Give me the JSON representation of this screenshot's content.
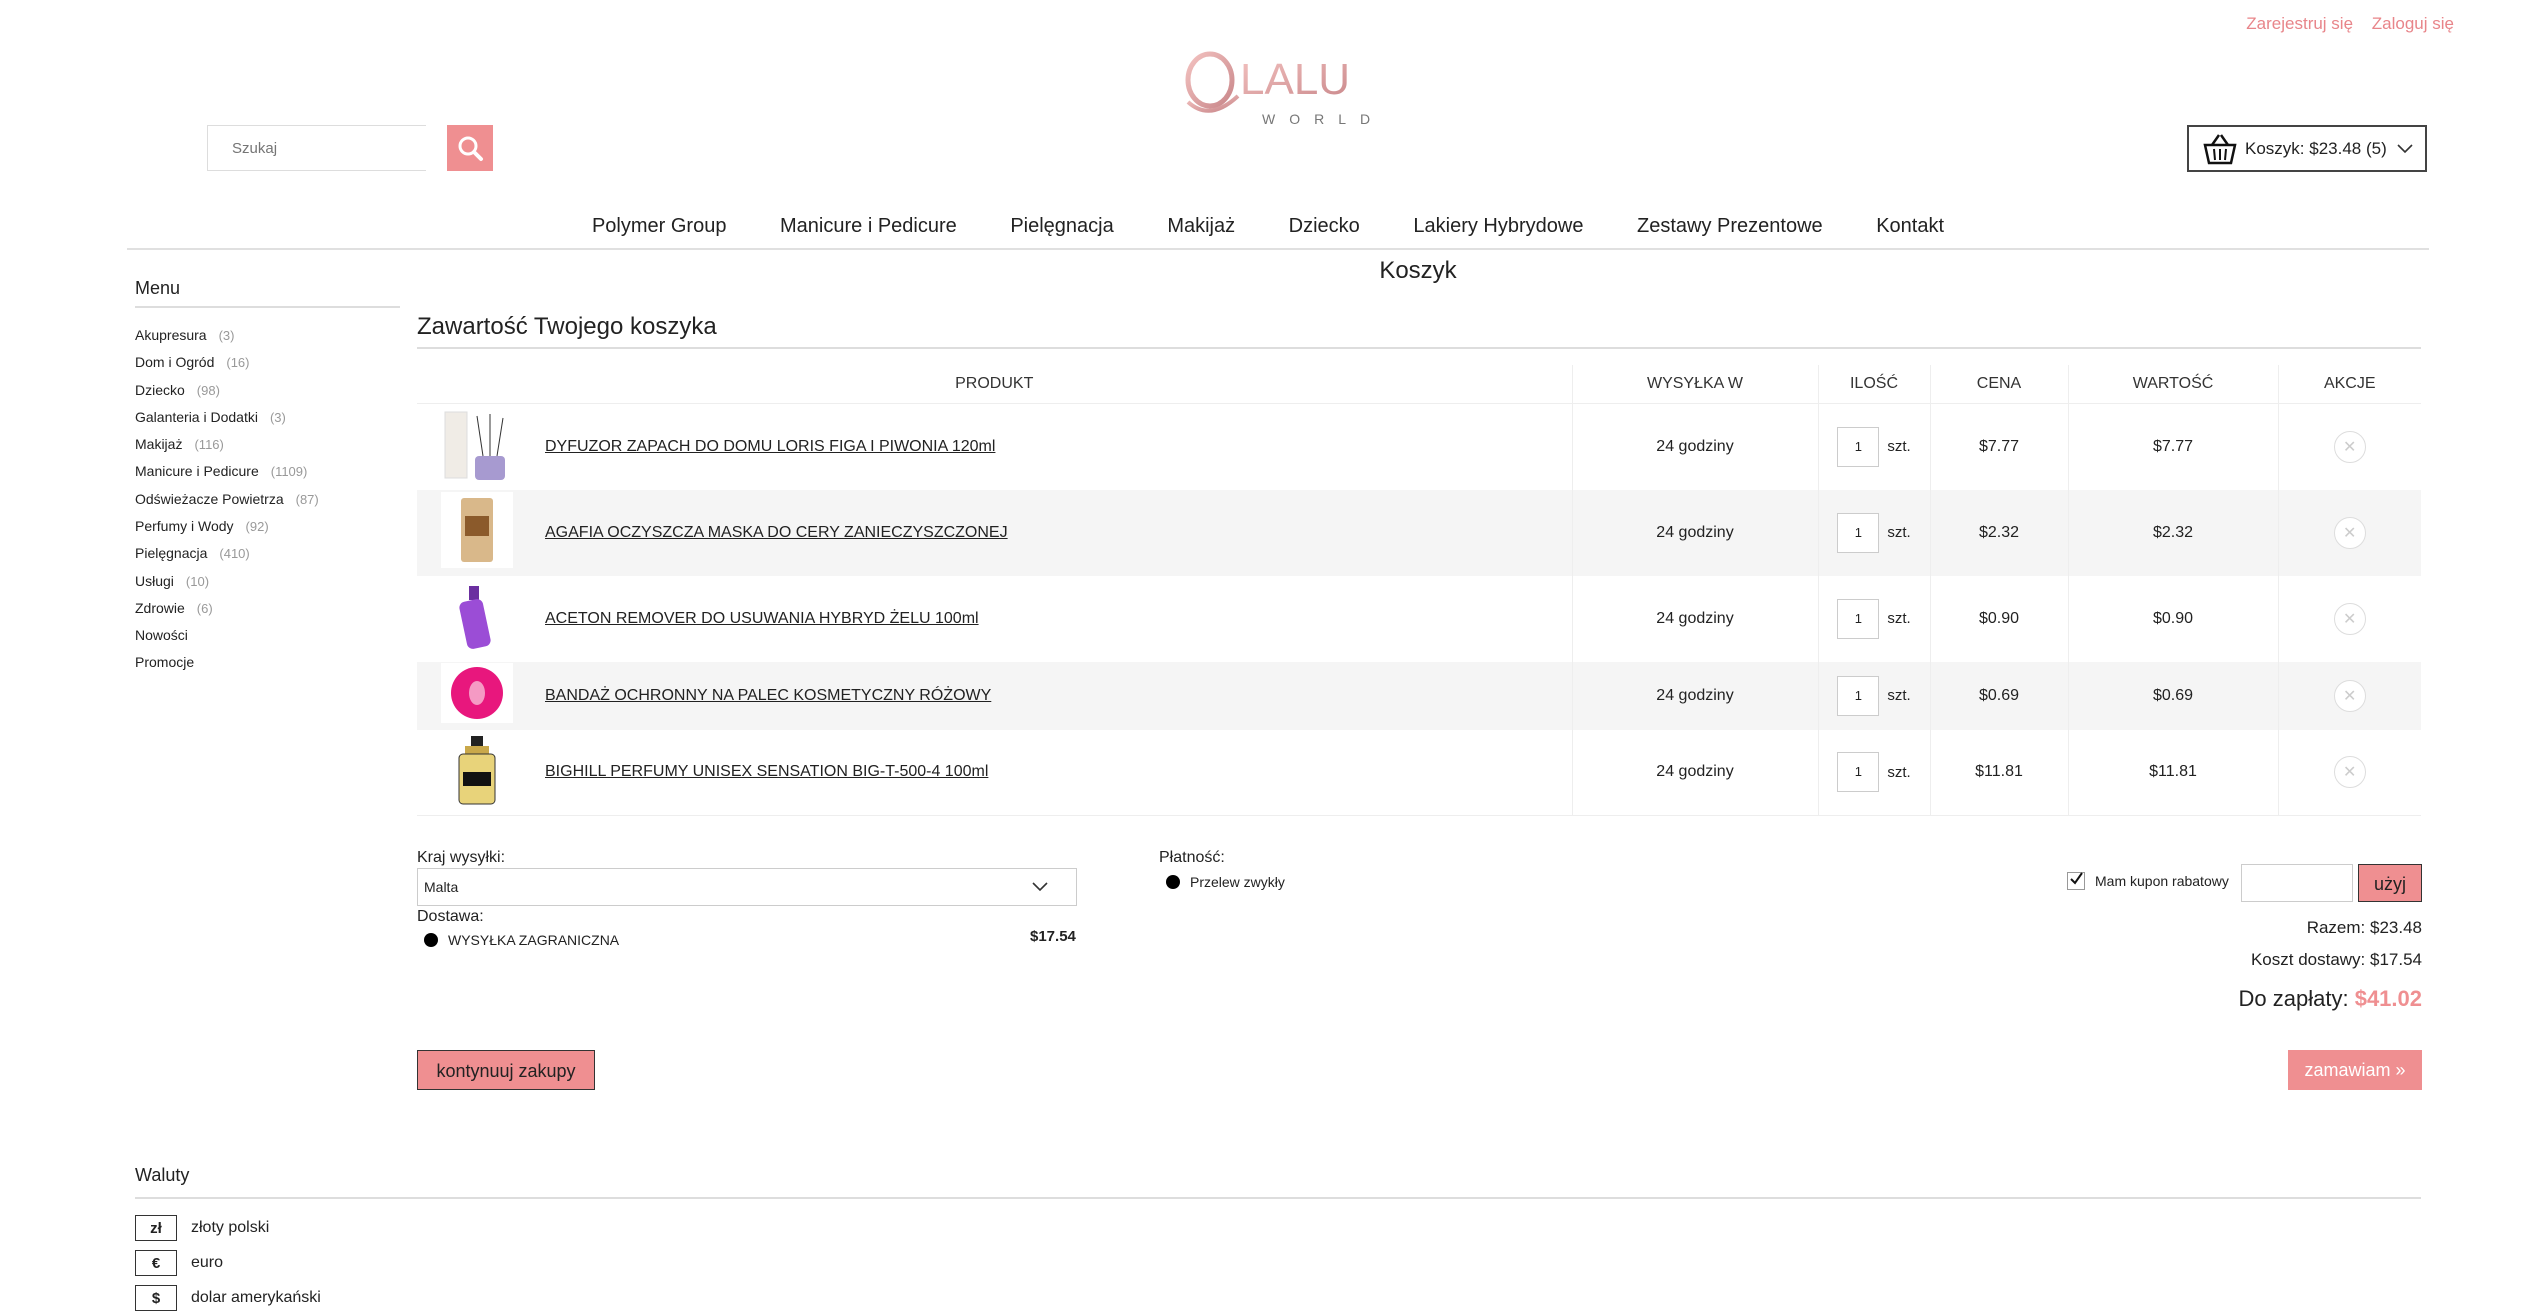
{
  "top": {
    "register": "Zarejestruj się",
    "login": "Zaloguj się"
  },
  "logo": {
    "brand": "LALU",
    "sub": "WORLD"
  },
  "search": {
    "placeholder": "Szukaj"
  },
  "cart": {
    "label": "Koszyk: $23.48 (5)"
  },
  "nav": [
    "Polymer Group",
    "Manicure i Pedicure",
    "Pielęgnacja",
    "Makijaż",
    "Dziecko",
    "Lakiery Hybrydowe",
    "Zestawy Prezentowe",
    "Kontakt"
  ],
  "page_title": "Koszyk",
  "sidebar": {
    "title": "Menu",
    "items": [
      {
        "label": "Akupresura",
        "count": "(3)"
      },
      {
        "label": "Dom i Ogród",
        "count": "(16)"
      },
      {
        "label": "Dziecko",
        "count": "(98)"
      },
      {
        "label": "Galanteria i Dodatki",
        "count": "(3)"
      },
      {
        "label": "Makijaż",
        "count": "(116)"
      },
      {
        "label": "Manicure i Pedicure",
        "count": "(1109)"
      },
      {
        "label": "Odświeżacze Powietrza",
        "count": "(87)"
      },
      {
        "label": "Perfumy i Wody",
        "count": "(92)"
      },
      {
        "label": "Pielęgnacja",
        "count": "(410)"
      },
      {
        "label": "Usługi",
        "count": "(10)"
      },
      {
        "label": "Zdrowie",
        "count": "(6)"
      },
      {
        "label": "Nowości",
        "count": ""
      },
      {
        "label": "Promocje",
        "count": ""
      }
    ]
  },
  "cart_section": {
    "title": "Zawartość Twojego koszyka",
    "headers": [
      "PRODUKT",
      "WYSYŁKA W",
      "ILOŚĆ",
      "CENA",
      "WARTOŚĆ",
      "AKCJE"
    ],
    "rows": [
      {
        "name": "DYFUZOR ZAPACH DO DOMU LORIS FIGA I PIWONIA 120ml",
        "ship": "24 godziny",
        "qty": "1",
        "unit": "szt.",
        "price": "$7.77",
        "value": "$7.77",
        "thumb": "diffuser"
      },
      {
        "name": "AGAFIA OCZYSZCZA MASKA DO CERY ZANIECZYSZCZONEJ",
        "ship": "24 godziny",
        "qty": "1",
        "unit": "szt.",
        "price": "$2.32",
        "value": "$2.32",
        "thumb": "sachet"
      },
      {
        "name": "ACETON REMOVER DO USUWANIA HYBRYD ŻELU 100ml",
        "ship": "24 godziny",
        "qty": "1",
        "unit": "szt.",
        "price": "$0.90",
        "value": "$0.90",
        "thumb": "bottle-purple"
      },
      {
        "name": "BANDAŻ OCHRONNY NA PALEC KOSMETYCZNY RÓŻOWY",
        "ship": "24 godziny",
        "qty": "1",
        "unit": "szt.",
        "price": "$0.69",
        "value": "$0.69",
        "thumb": "tape-pink"
      },
      {
        "name": "BIGHILL PERFUMY UNISEX SENSATION BIG-T-500-4 100ml",
        "ship": "24 godziny",
        "qty": "1",
        "unit": "szt.",
        "price": "$11.81",
        "value": "$11.81",
        "thumb": "perfume"
      }
    ]
  },
  "shipping": {
    "country_label": "Kraj wysyłki:",
    "country": "Malta",
    "delivery_label": "Dostawa:",
    "delivery_option": "WYSYŁKA ZAGRANICZNA",
    "delivery_price": "$17.54"
  },
  "payment": {
    "label": "Płatność:",
    "option": "Przelew zwykły"
  },
  "coupon": {
    "label": "Mam kupon rabatowy",
    "button": "użyj"
  },
  "totals": {
    "sum": "Razem: $23.48",
    "shipping": "Koszt dostawy: $17.54",
    "pay_label": "Do zapłaty:",
    "pay_value": "$41.02"
  },
  "buttons": {
    "continue": "kontynuuj zakupy",
    "order": "zamawiam »"
  },
  "currencies": {
    "title": "Waluty",
    "items": [
      {
        "symbol": "zł",
        "name": "złoty polski"
      },
      {
        "symbol": "€",
        "name": "euro"
      },
      {
        "symbol": "$",
        "name": "dolar amerykański"
      }
    ]
  },
  "colors": {
    "accent": "#ef8f91",
    "link": "#e8858a"
  }
}
